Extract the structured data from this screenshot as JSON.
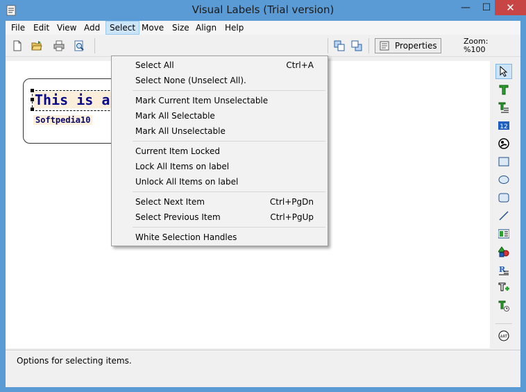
{
  "window": {
    "title": "Visual Labels (Trial version)"
  },
  "menubar": [
    "File",
    "Edit",
    "View",
    "Add",
    "Select",
    "Move",
    "Size",
    "Align",
    "Help"
  ],
  "toolbar": {
    "properties_label": "Properties",
    "zoom_label": "Zoom:",
    "zoom_value": "%100"
  },
  "canvas": {
    "label_text_1": "This is a Softpedia",
    "label_text_2": "Softpedia10"
  },
  "select_menu": {
    "select_all": "Select All",
    "select_all_shortcut": "Ctrl+A",
    "select_none": "Select None (Unselect All).",
    "mark_current_unselectable": "Mark Current Item Unselectable",
    "mark_all_selectable": "Mark All Selectable",
    "mark_all_unselectable": "Mark All Unselectable",
    "current_item_locked": "Current Item Locked",
    "lock_all_items": "Lock All Items on label",
    "unlock_all_items": "Unlock All Items on label",
    "select_next": "Select Next Item",
    "select_next_shortcut": "Ctrl+PgDn",
    "select_previous": "Select Previous Item",
    "select_previous_shortcut": "Ctrl+PgUp",
    "white_selection_handles": "White Selection Handles"
  },
  "statusbar": {
    "text": "Options for selecting items."
  },
  "colors": {
    "title_bar": "#5a9bd5",
    "close_button": "#c74545",
    "menu_highlight": "#cce4f7",
    "label_text": "#0a0a8a"
  }
}
